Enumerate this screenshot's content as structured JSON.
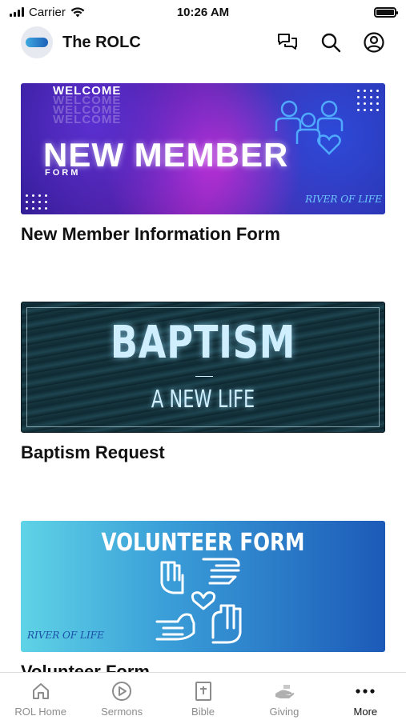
{
  "status_bar": {
    "carrier": "Carrier",
    "time": "10:26 AM"
  },
  "header": {
    "title": "The ROLC",
    "icons": [
      "chat-icon",
      "search-icon",
      "account-icon"
    ]
  },
  "cards": [
    {
      "title": "New Member Information Form",
      "banner": {
        "welcome": "WELCOME",
        "headline": "NEW MEMBER",
        "subline": "FORM",
        "logo_text": "RIVER OF LIFE"
      }
    },
    {
      "title": "Baptism Request",
      "banner": {
        "headline": "BAPTISM",
        "subline": "A NEW LIFE"
      }
    },
    {
      "title": "Volunteer Form",
      "banner": {
        "headline": "VOLUNTEER FORM",
        "logo_text": "RIVER OF LIFE"
      }
    }
  ],
  "tab_bar": {
    "tabs": [
      {
        "label": "ROL Home",
        "icon": "home-icon",
        "active": false
      },
      {
        "label": "Sermons",
        "icon": "play-icon",
        "active": false
      },
      {
        "label": "Bible",
        "icon": "bible-icon",
        "active": false
      },
      {
        "label": "Giving",
        "icon": "giving-icon",
        "active": false
      },
      {
        "label": "More",
        "icon": "more-icon",
        "active": true
      }
    ]
  },
  "colors": {
    "active_tab": "#111111",
    "inactive_tab": "#8c8c8c"
  }
}
